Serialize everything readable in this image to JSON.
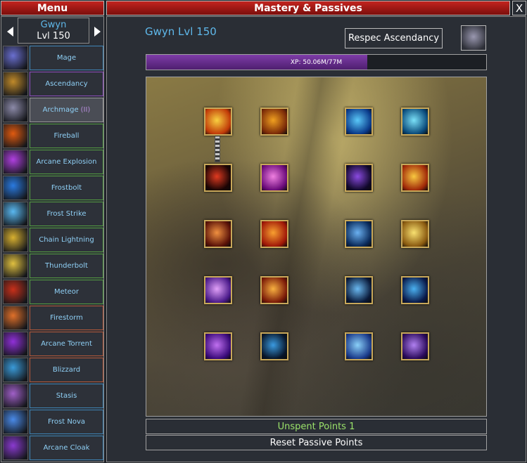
{
  "menu": {
    "title": "Menu"
  },
  "main": {
    "title": "Mastery & Passives"
  },
  "close_label": "X",
  "character": {
    "name": "Gwyn",
    "level": "Lvl 150"
  },
  "sidebar": {
    "items": [
      {
        "label": "Mage",
        "icon": "mage-icon",
        "color": "#6a6fd0",
        "border": "blue"
      },
      {
        "label": "Ascendancy",
        "icon": "crown-icon",
        "color": "#c08a2a",
        "border": "purple"
      },
      {
        "label": "Archmage",
        "tier": "(II)",
        "icon": "bell-icon",
        "color": "#8c8aa8",
        "border": "active"
      },
      {
        "label": "Fireball",
        "icon": "fireball-icon",
        "color": "#e05a10",
        "border": "green"
      },
      {
        "label": "Arcane Explosion",
        "icon": "arcane-explosion-icon",
        "color": "#b040e0",
        "border": "green"
      },
      {
        "label": "Frostbolt",
        "icon": "frostbolt-icon",
        "color": "#2a7ae0",
        "border": "green"
      },
      {
        "label": "Frost Strike",
        "icon": "frost-strike-icon",
        "color": "#5ab8f0",
        "border": "green"
      },
      {
        "label": "Chain Lightning",
        "icon": "chain-lightning-icon",
        "color": "#d8b030",
        "border": "green"
      },
      {
        "label": "Thunderbolt",
        "icon": "thunderbolt-icon",
        "color": "#e0c040",
        "border": "green"
      },
      {
        "label": "Meteor",
        "icon": "meteor-icon",
        "color": "#c8301a",
        "border": "green"
      },
      {
        "label": "Firestorm",
        "icon": "firestorm-icon",
        "color": "#e0702a",
        "border": "orange"
      },
      {
        "label": "Arcane Torrent",
        "icon": "arcane-torrent-icon",
        "color": "#9030d8",
        "border": "orange"
      },
      {
        "label": "Blizzard",
        "icon": "blizzard-icon",
        "color": "#3a9ad8",
        "border": "orange"
      },
      {
        "label": "Stasis",
        "icon": "stasis-icon",
        "color": "#a060c8",
        "border": "blue"
      },
      {
        "label": "Frost Nova",
        "icon": "frost-nova-icon",
        "color": "#4a8ae8",
        "border": "blue"
      },
      {
        "label": "Arcane Cloak",
        "icon": "arcane-cloak-icon",
        "color": "#8a3ad0",
        "border": "blue"
      }
    ]
  },
  "player_title": "Gwyn Lvl 150",
  "respec": {
    "label": "Respec Ascendancy",
    "icon": "bell-icon"
  },
  "xp": {
    "text": "XP: 50.06M/77M",
    "current": 50.06,
    "max": 77
  },
  "passive_nodes": [
    {
      "icon": "fire-swirl-icon",
      "c1": "#f8d040",
      "c2": "#c03a08"
    },
    {
      "icon": "fire-bird-icon",
      "c1": "#f0a020",
      "c2": "#7a2a08"
    },
    {
      "icon": "vortex-icon",
      "c1": "#5ac8f8",
      "c2": "#0a3a8a"
    },
    {
      "icon": "ice-comet-icon",
      "c1": "#7ae0f8",
      "c2": "#0a4a7a"
    },
    {
      "icon": "dark-fire-icon",
      "c1": "#e03a20",
      "c2": "#1a0404"
    },
    {
      "icon": "arcane-glyph-icon",
      "c1": "#f080e0",
      "c2": "#6a0a7a"
    },
    {
      "icon": "shadow-dragon-icon",
      "c1": "#8a4ae0",
      "c2": "#10082a"
    },
    {
      "icon": "solar-burst-icon",
      "c1": "#f8c840",
      "c2": "#a02808"
    },
    {
      "icon": "ember-claw-icon",
      "c1": "#f09040",
      "c2": "#5a1208"
    },
    {
      "icon": "inferno-icon",
      "c1": "#f8a030",
      "c2": "#a01808"
    },
    {
      "icon": "frost-claw-icon",
      "c1": "#6ab0f0",
      "c2": "#0a2a5a"
    },
    {
      "icon": "thunder-horn-icon",
      "c1": "#f8e070",
      "c2": "#8a5a10"
    },
    {
      "icon": "arcane-strike-icon",
      "c1": "#e0a0f8",
      "c2": "#4a1a8a"
    },
    {
      "icon": "phoenix-icon",
      "c1": "#f8b040",
      "c2": "#7a1a08"
    },
    {
      "icon": "rune-triangle-icon",
      "c1": "#6ab8f0",
      "c2": "#0a1a3a"
    },
    {
      "icon": "ice-wave-icon",
      "c1": "#4ab0f0",
      "c2": "#0a1a4a"
    },
    {
      "icon": "arcane-orb-icon",
      "c1": "#c070f0",
      "c2": "#3a0a7a"
    },
    {
      "icon": "arcane-sentinel-icon",
      "c1": "#3a9ae0",
      "c2": "#08162a"
    },
    {
      "icon": "ice-shards-icon",
      "c1": "#8ad0f8",
      "c2": "#1a3a8a"
    },
    {
      "icon": "void-raven-icon",
      "c1": "#b080f0",
      "c2": "#2a0a5a"
    }
  ],
  "unspent_points": "Unspent Points 1",
  "reset_label": "Reset Passive Points"
}
